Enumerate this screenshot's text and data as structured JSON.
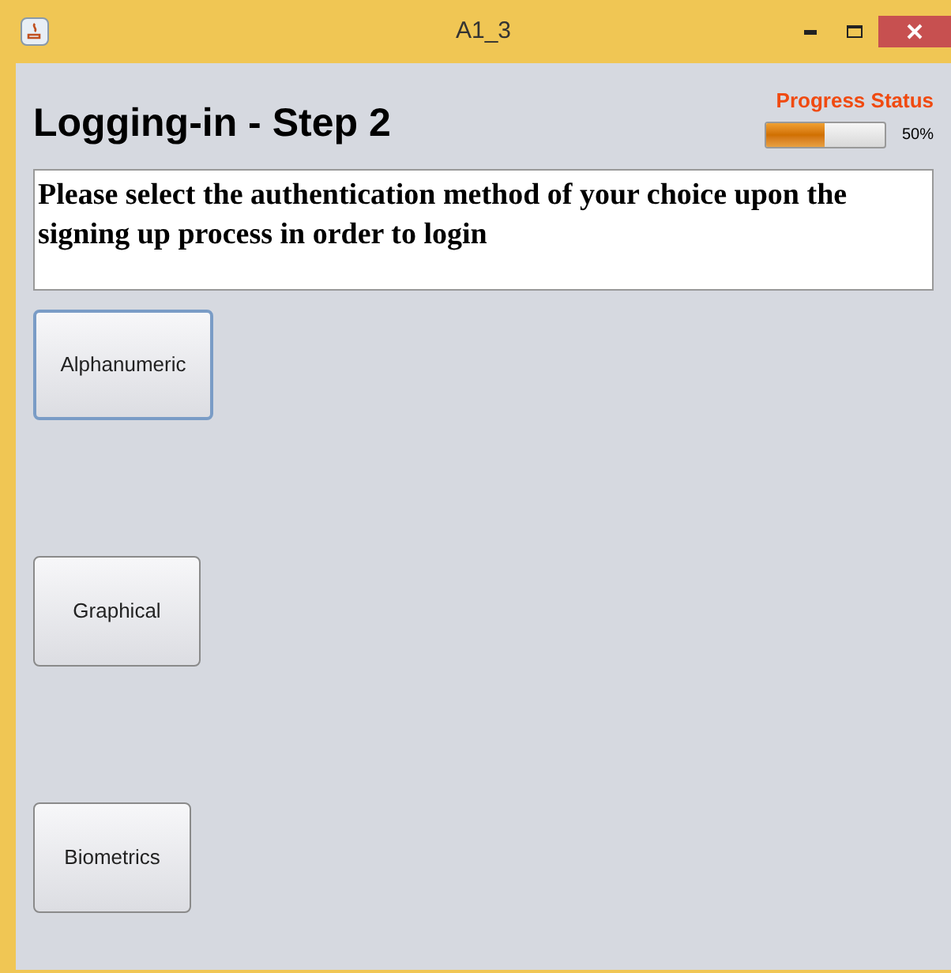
{
  "window": {
    "title": "A1_3"
  },
  "heading": "Logging-in - Step 2",
  "progress": {
    "label": "Progress Status",
    "level": 0.5,
    "reading": "50%"
  },
  "instructions": "Please select the authentication method of your choice upon the signing up process in order to login",
  "methods": [
    {
      "label": "Alphanumeric",
      "focused": true
    },
    {
      "label": "Graphical",
      "focused": false
    },
    {
      "label": "Biometrics",
      "focused": false
    }
  ]
}
